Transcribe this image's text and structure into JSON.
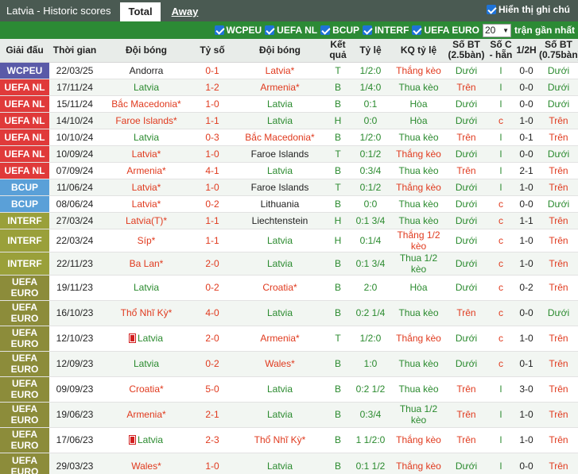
{
  "header": {
    "title": "Latvia - Historic scores",
    "tab_total": "Total",
    "tab_away": "Away",
    "show_notes": "Hiển thị ghi chú"
  },
  "filters": {
    "competitions": [
      "WCPEU",
      "UEFA NL",
      "BCUP",
      "INTERF",
      "UEFA EURO"
    ],
    "count": "20",
    "latest_label": "trận gần nhất"
  },
  "columns": [
    "Giải đấu",
    "Thời gian",
    "Đội bóng",
    "Tỷ số",
    "Đội bóng",
    "Kết quả",
    "Tỷ lệ",
    "KQ tỷ lệ",
    "Số BT (2.5bàn)",
    "Số C - hẵn",
    "1/2H",
    "Số BT (0.75bàn)"
  ],
  "colors": {
    "WCPEU": "#5a5aa8",
    "UEFA NL": "#e03a3a",
    "BCUP": "#5aa0d8",
    "INTERF": "#9aa03a",
    "UEFA EURO": "#8c8c3a"
  },
  "rows": [
    {
      "comp": "WCPEU",
      "date": "22/03/25",
      "home": "Andorra",
      "score": "0-1",
      "away": "Latvia*",
      "res": "T",
      "odds": "1/2:0",
      "kq": "Thắng kèo",
      "ou": "Dưới",
      "oe": "l",
      "half": "0-0",
      "ou2": "Dưới"
    },
    {
      "comp": "UEFA NL",
      "date": "17/11/24",
      "home": "Latvia",
      "score": "1-2",
      "away": "Armenia*",
      "res": "B",
      "odds": "1/4:0",
      "kq": "Thua kèo",
      "ou": "Trên",
      "oe": "l",
      "half": "0-0",
      "ou2": "Dưới"
    },
    {
      "comp": "UEFA NL",
      "date": "15/11/24",
      "home": "Bắc Macedonia*",
      "score": "1-0",
      "away": "Latvia",
      "res": "B",
      "odds": "0:1",
      "kq": "Hòa",
      "ou": "Dưới",
      "oe": "l",
      "half": "0-0",
      "ou2": "Dưới"
    },
    {
      "comp": "UEFA NL",
      "date": "14/10/24",
      "home": "Faroe Islands*",
      "score": "1-1",
      "away": "Latvia",
      "res": "H",
      "odds": "0:0",
      "kq": "Hòa",
      "ou": "Dưới",
      "oe": "c",
      "half": "1-0",
      "ou2": "Trên"
    },
    {
      "comp": "UEFA NL",
      "date": "10/10/24",
      "home": "Latvia",
      "score": "0-3",
      "away": "Bắc Macedonia*",
      "res": "B",
      "odds": "1/2:0",
      "kq": "Thua kèo",
      "ou": "Trên",
      "oe": "l",
      "half": "0-1",
      "ou2": "Trên"
    },
    {
      "comp": "UEFA NL",
      "date": "10/09/24",
      "home": "Latvia*",
      "score": "1-0",
      "away": "Faroe Islands",
      "res": "T",
      "odds": "0:1/2",
      "kq": "Thắng kèo",
      "ou": "Dưới",
      "oe": "l",
      "half": "0-0",
      "ou2": "Dưới"
    },
    {
      "comp": "UEFA NL",
      "date": "07/09/24",
      "home": "Armenia*",
      "score": "4-1",
      "away": "Latvia",
      "res": "B",
      "odds": "0:3/4",
      "kq": "Thua kèo",
      "ou": "Trên",
      "oe": "l",
      "half": "2-1",
      "ou2": "Trên"
    },
    {
      "comp": "BCUP",
      "date": "11/06/24",
      "home": "Latvia*",
      "score": "1-0",
      "away": "Faroe Islands",
      "res": "T",
      "odds": "0:1/2",
      "kq": "Thắng kèo",
      "ou": "Dưới",
      "oe": "l",
      "half": "1-0",
      "ou2": "Trên"
    },
    {
      "comp": "BCUP",
      "date": "08/06/24",
      "home": "Latvia*",
      "score": "0-2",
      "away": "Lithuania",
      "res": "B",
      "odds": "0:0",
      "kq": "Thua kèo",
      "ou": "Dưới",
      "oe": "c",
      "half": "0-0",
      "ou2": "Dưới"
    },
    {
      "comp": "INTERF",
      "date": "27/03/24",
      "home": "Latvia(T)*",
      "score": "1-1",
      "away": "Liechtenstein",
      "res": "H",
      "odds": "0:1 3/4",
      "kq": "Thua kèo",
      "ou": "Dưới",
      "oe": "c",
      "half": "1-1",
      "ou2": "Trên"
    },
    {
      "comp": "INTERF",
      "date": "22/03/24",
      "home": "Síp*",
      "score": "1-1",
      "away": "Latvia",
      "res": "H",
      "odds": "0:1/4",
      "kq": "Thắng 1/2 kèo",
      "ou": "Dưới",
      "oe": "c",
      "half": "1-0",
      "ou2": "Trên"
    },
    {
      "comp": "INTERF",
      "date": "22/11/23",
      "home": "Ba Lan*",
      "score": "2-0",
      "away": "Latvia",
      "res": "B",
      "odds": "0:1 3/4",
      "kq": "Thua 1/2 kèo",
      "ou": "Dưới",
      "oe": "c",
      "half": "1-0",
      "ou2": "Trên"
    },
    {
      "comp": "UEFA EURO",
      "date": "19/11/23",
      "home": "Latvia",
      "score": "0-2",
      "away": "Croatia*",
      "res": "B",
      "odds": "2:0",
      "kq": "Hòa",
      "ou": "Dưới",
      "oe": "c",
      "half": "0-2",
      "ou2": "Trên"
    },
    {
      "comp": "UEFA EURO",
      "date": "16/10/23",
      "home": "Thổ Nhĩ Kỳ*",
      "score": "4-0",
      "away": "Latvia",
      "res": "B",
      "odds": "0:2 1/4",
      "kq": "Thua kèo",
      "ou": "Trên",
      "oe": "c",
      "half": "0-0",
      "ou2": "Dưới"
    },
    {
      "comp": "UEFA EURO",
      "date": "12/10/23",
      "home": "Latvia",
      "homeFlag": true,
      "score": "2-0",
      "away": "Armenia*",
      "res": "T",
      "odds": "1/2:0",
      "kq": "Thắng kèo",
      "ou": "Dưới",
      "oe": "c",
      "half": "1-0",
      "ou2": "Trên"
    },
    {
      "comp": "UEFA EURO",
      "date": "12/09/23",
      "home": "Latvia",
      "score": "0-2",
      "away": "Wales*",
      "res": "B",
      "odds": "1:0",
      "kq": "Thua kèo",
      "ou": "Dưới",
      "oe": "c",
      "half": "0-1",
      "ou2": "Trên"
    },
    {
      "comp": "UEFA EURO",
      "date": "09/09/23",
      "home": "Croatia*",
      "score": "5-0",
      "away": "Latvia",
      "res": "B",
      "odds": "0:2 1/2",
      "kq": "Thua kèo",
      "ou": "Trên",
      "oe": "l",
      "half": "3-0",
      "ou2": "Trên"
    },
    {
      "comp": "UEFA EURO",
      "date": "19/06/23",
      "home": "Armenia*",
      "score": "2-1",
      "away": "Latvia",
      "res": "B",
      "odds": "0:3/4",
      "kq": "Thua 1/2 kèo",
      "ou": "Trên",
      "oe": "l",
      "half": "1-0",
      "ou2": "Trên"
    },
    {
      "comp": "UEFA EURO",
      "date": "17/06/23",
      "home": "Latvia",
      "homeFlag": true,
      "score": "2-3",
      "away": "Thổ Nhĩ Kỳ*",
      "res": "B",
      "odds": "1 1/2:0",
      "kq": "Thắng kèo",
      "ou": "Trên",
      "oe": "l",
      "half": "1-0",
      "ou2": "Trên"
    },
    {
      "comp": "UEFA EURO",
      "date": "29/03/23",
      "home": "Wales*",
      "score": "1-0",
      "away": "Latvia",
      "res": "B",
      "odds": "0:1 1/2",
      "kq": "Thắng kèo",
      "ou": "Dưới",
      "oe": "l",
      "half": "0-0",
      "ou2": "Trên"
    }
  ]
}
